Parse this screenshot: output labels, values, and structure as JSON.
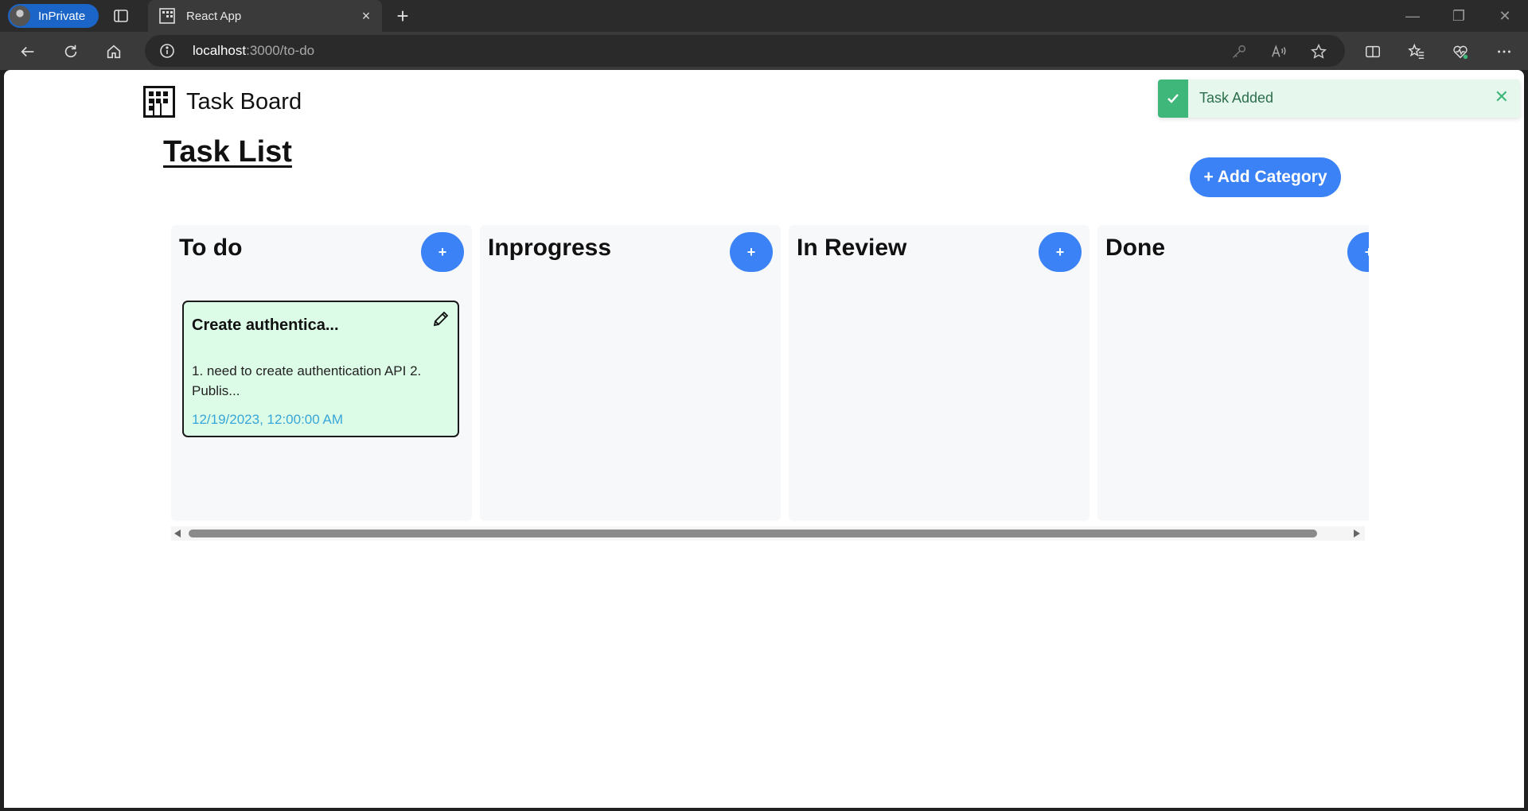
{
  "browser": {
    "profile_label": "InPrivate",
    "tab_title": "React App",
    "url_host": "localhost",
    "url_path": ":3000/to-do"
  },
  "app": {
    "brand_name": "Task Board",
    "page_heading": "Task List",
    "add_category_label": "+ Add Category",
    "add_task_label": "+"
  },
  "columns": [
    {
      "title": "To do",
      "cards": [
        {
          "title": "Create authentica...",
          "description": "1. need to create authentication API 2. Publis...",
          "date": "12/19/2023, 12:00:00 AM"
        }
      ]
    },
    {
      "title": "Inprogress",
      "cards": []
    },
    {
      "title": "In Review",
      "cards": []
    },
    {
      "title": "Done",
      "cards": []
    }
  ],
  "toast": {
    "message": "Task Added",
    "status": "success"
  },
  "colors": {
    "accent": "#3b82f6",
    "card_bg": "#dcfce7",
    "date_text": "#38a6d8",
    "toast_bg": "#e6f7ee",
    "toast_accent": "#3fb67a"
  }
}
